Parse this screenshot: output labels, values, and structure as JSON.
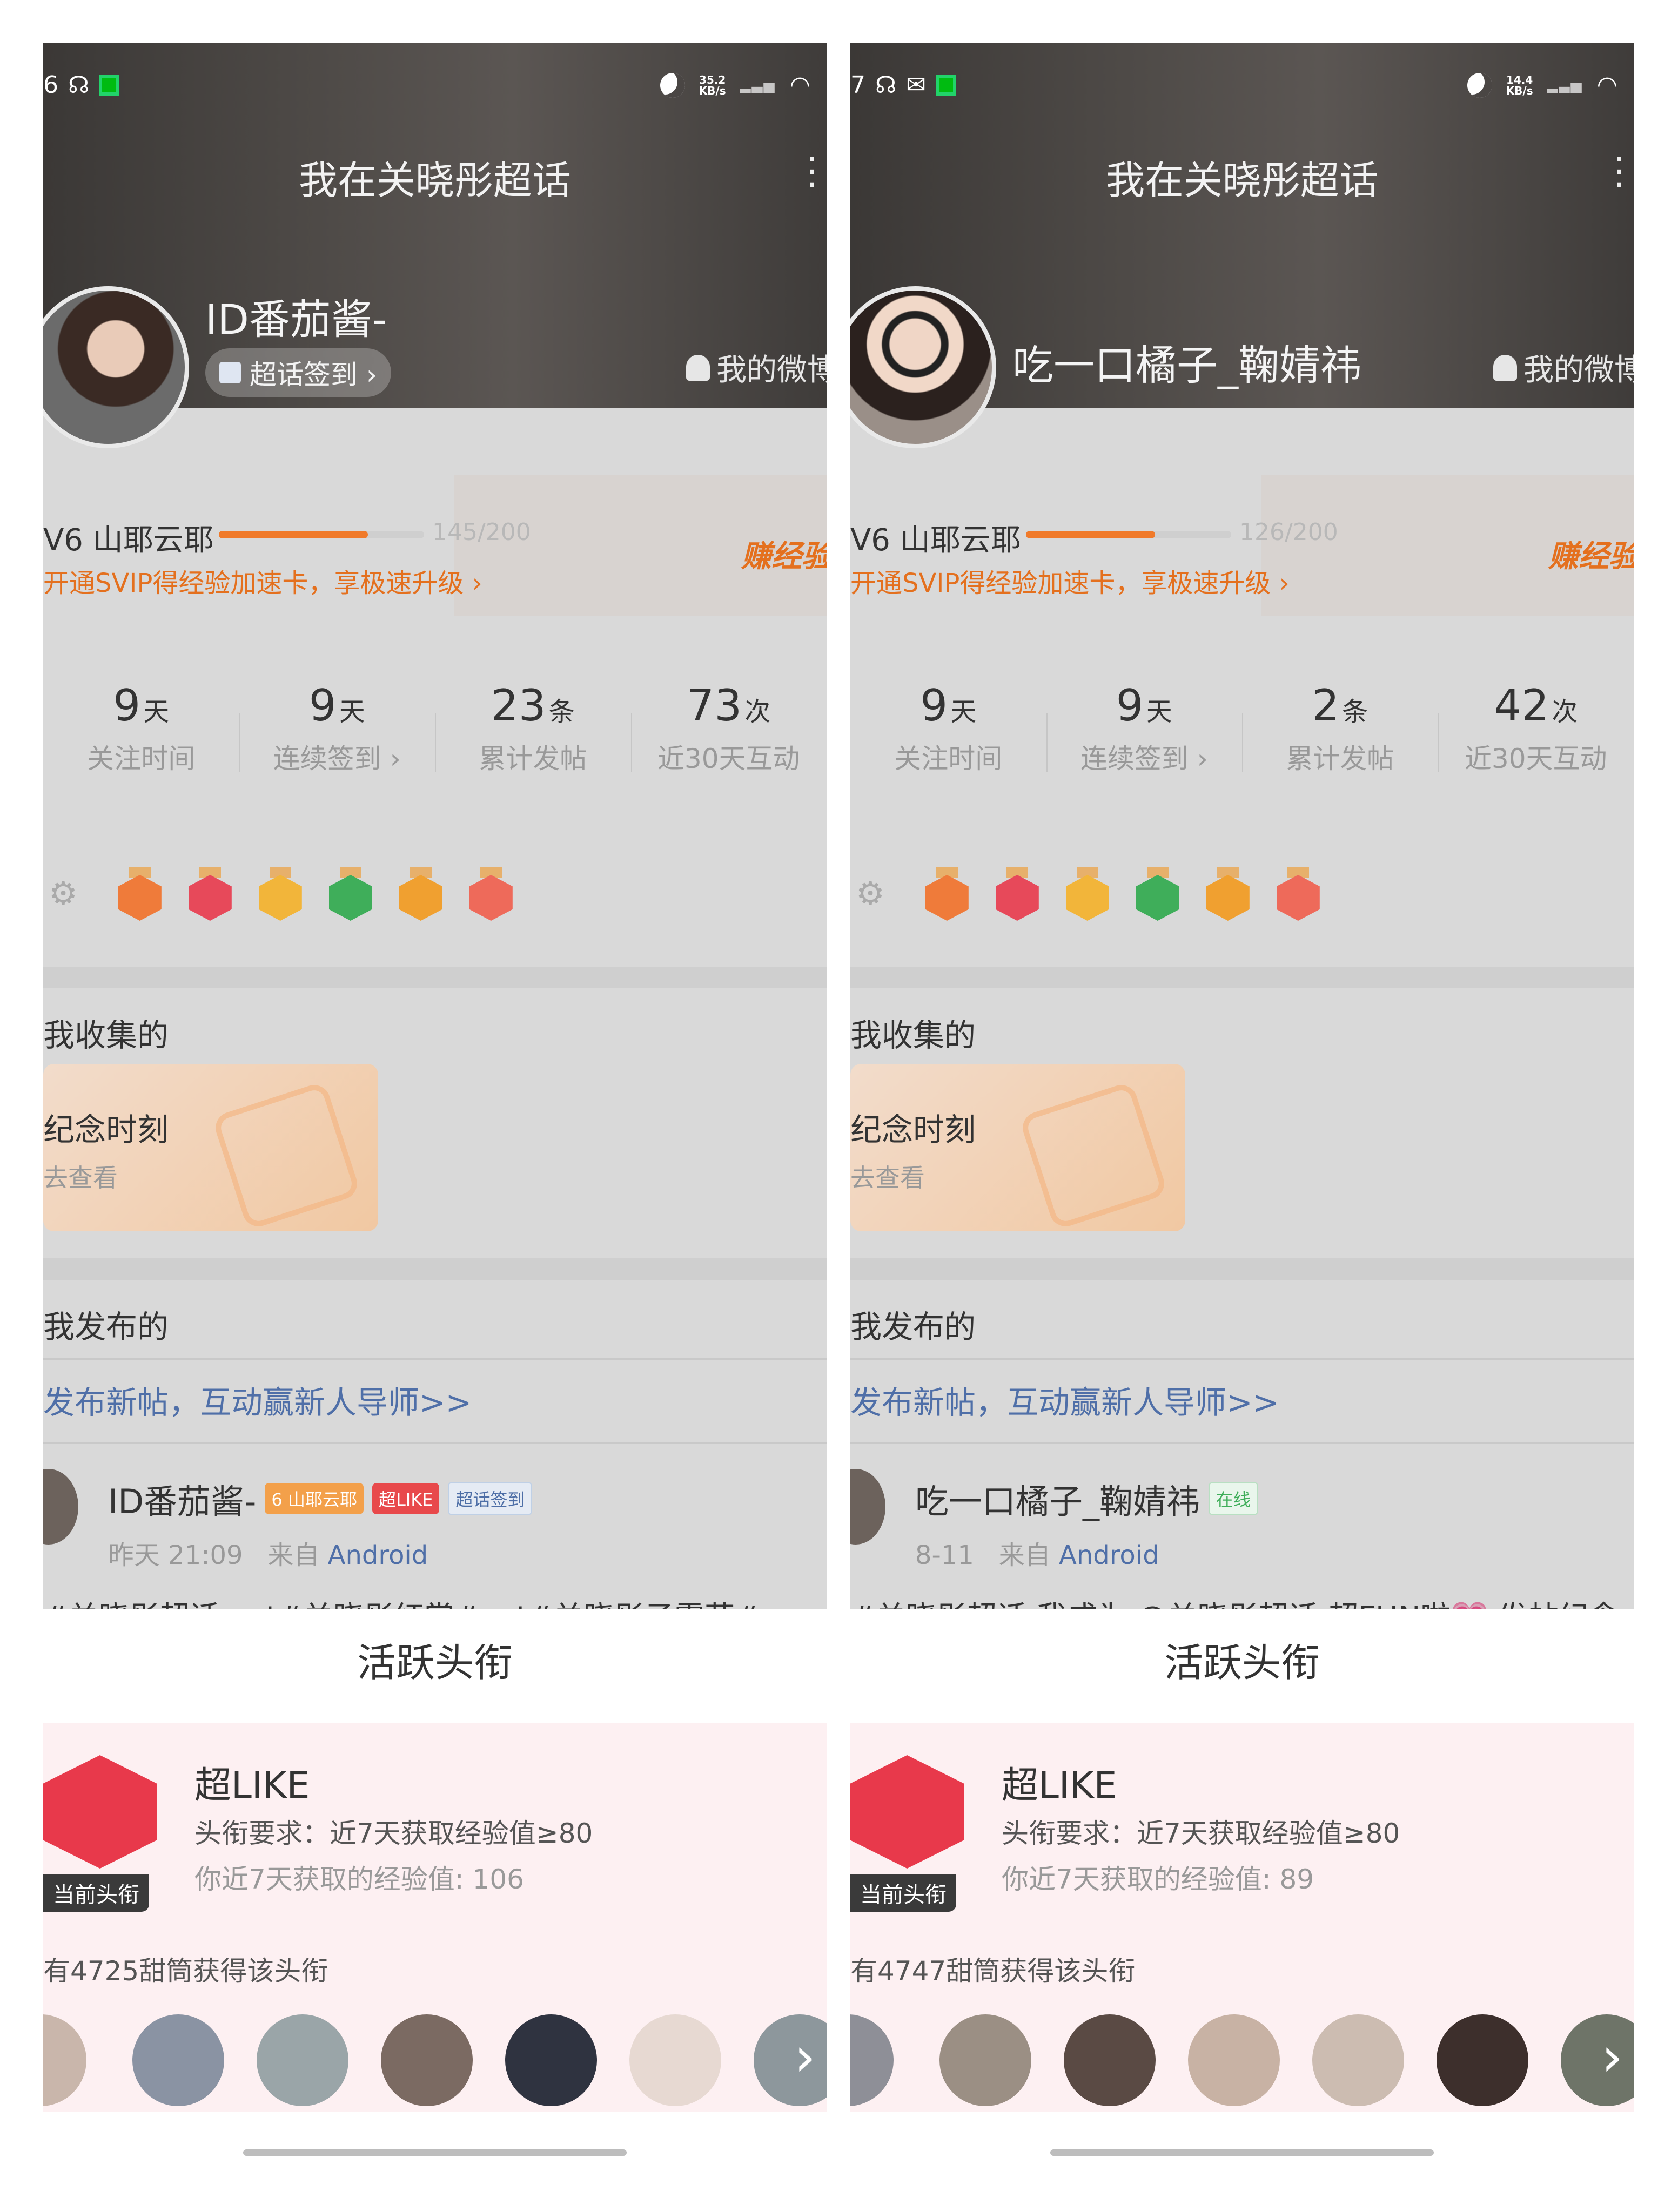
{
  "panels": [
    {
      "status": {
        "time": "6",
        "speed": "35.2",
        "speed_unit": "KB/s"
      },
      "page_title": "我在关晓彤超话",
      "username": "ID番茄酱-",
      "checkin_label": "超话签到 ›",
      "myweibo_label": "我的微博",
      "level": {
        "label": "V6 山耶云耶",
        "exp_text": "145/200",
        "exp_fraction": 0.725
      },
      "svip_text": "开通SVIP得经验加速卡，享极速升级 ›",
      "earn_text": "赚经验",
      "stats": [
        {
          "num": "9",
          "unit": "天",
          "label": "关注时间"
        },
        {
          "num": "9",
          "unit": "天",
          "label": "连续签到 ›"
        },
        {
          "num": "23",
          "unit": "条",
          "label": "累计发帖"
        },
        {
          "num": "73",
          "unit": "次",
          "label": "近30天互动"
        }
      ],
      "collected_title": "我收集的",
      "memory_title": "纪念时刻",
      "memory_view": "去查看",
      "published_title": "我发布的",
      "newpost_text": "发布新帖，互动赢新人导师>>",
      "post": {
        "name": "ID番茄酱-",
        "tags": [
          "6 山耶云耶",
          "超LIKE",
          "超话签到"
        ],
        "time": "昨天 21:09",
        "from": "来自",
        "source": "Android",
        "text": "#关晓彤超话 ovt#关晓彤红裳#ovt#关晓彤子露菇#"
      },
      "sheet": {
        "title": "活跃头衔",
        "title_name": "超LIKE",
        "requirement": "头衔要求：近7天获取经验值≥80",
        "mine": "你近7天获取的经验值: 106",
        "current_tag": "当前头衔",
        "count_text": "有4725甜筒获得该头衔"
      }
    },
    {
      "status": {
        "time": "7",
        "speed": "14.4",
        "speed_unit": "KB/s"
      },
      "page_title": "我在关晓彤超话",
      "username": "吃一口橘子_鞠婧祎",
      "myweibo_label": "我的微博",
      "level": {
        "label": "V6 山耶云耶",
        "exp_text": "126/200",
        "exp_fraction": 0.63
      },
      "svip_text": "开通SVIP得经验加速卡，享极速升级 ›",
      "earn_text": "赚经验",
      "stats": [
        {
          "num": "9",
          "unit": "天",
          "label": "关注时间"
        },
        {
          "num": "9",
          "unit": "天",
          "label": "连续签到 ›"
        },
        {
          "num": "2",
          "unit": "条",
          "label": "累计发帖"
        },
        {
          "num": "42",
          "unit": "次",
          "label": "近30天互动"
        }
      ],
      "collected_title": "我收集的",
      "memory_title": "纪念时刻",
      "memory_view": "去查看",
      "published_title": "我发布的",
      "newpost_text": "发布新帖，互动赢新人导师>>",
      "post": {
        "name": "吃一口橘子_鞠婧祎",
        "tags": [
          "在线"
        ],
        "time": "8-11",
        "from": "来自",
        "source": "Android",
        "text": "#关晓彤超话 我成为 @关晓彤超话 超FUN啦💗 发帖纪念"
      },
      "sheet": {
        "title": "活跃头衔",
        "title_name": "超LIKE",
        "requirement": "头衔要求：近7天获取经验值≥80",
        "mine": "你近7天获取的经验值: 89",
        "current_tag": "当前头衔",
        "count_text": "有4747甜筒获得该头衔"
      }
    }
  ],
  "colors": {
    "accent_orange": "#f07a2a",
    "link_blue": "#4f6fa8",
    "title_red": "#e8394b"
  }
}
